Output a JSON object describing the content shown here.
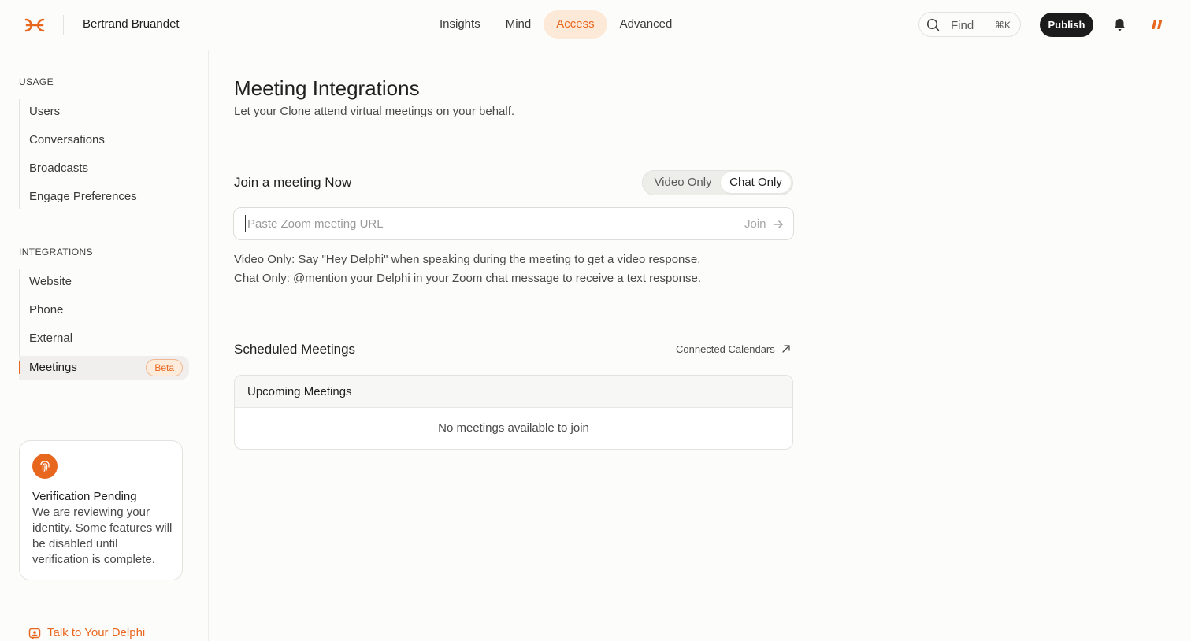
{
  "header": {
    "brand_name": "Bertrand Bruandet",
    "nav": [
      {
        "label": "Insights",
        "active": false
      },
      {
        "label": "Mind",
        "active": false
      },
      {
        "label": "Access",
        "active": true
      },
      {
        "label": "Advanced",
        "active": false
      }
    ],
    "find_label": "Find",
    "find_shortcut": "⌘K",
    "publish_label": "Publish",
    "icons": {
      "logo": "delphi-logo-icon",
      "search": "search-icon",
      "bell": "bell-icon",
      "app": "app-mark-icon"
    }
  },
  "sidebar": {
    "usage_title": "USAGE",
    "usage_items": [
      "Users",
      "Conversations",
      "Broadcasts",
      "Engage Preferences"
    ],
    "integrations_title": "INTEGRATIONS",
    "integration_items": [
      "Website",
      "Phone",
      "External",
      "Meetings"
    ],
    "active_item": "Meetings",
    "beta_badge": "Beta",
    "verification": {
      "title": "Verification Pending",
      "text": "We are reviewing your identity. Some features will be disabled until verification is complete."
    },
    "talk_link": "Talk to Your Delphi"
  },
  "main": {
    "title": "Meeting Integrations",
    "subtitle": "Let your Clone attend virtual meetings on your behalf.",
    "join": {
      "heading": "Join a meeting Now",
      "modes": [
        "Video Only",
        "Chat Only"
      ],
      "selected_mode": "Chat Only",
      "url_placeholder": "Paste Zoom meeting URL",
      "url_value": "",
      "join_label": "Join",
      "help_video": "Video Only: Say \"Hey Delphi\" when speaking during the meeting to get a video response.",
      "help_chat": "Chat Only: @mention your Delphi in your Zoom chat message to receive a text response."
    },
    "scheduled": {
      "heading": "Scheduled Meetings",
      "calendars_link": "Connected Calendars",
      "card_title": "Upcoming Meetings",
      "empty_text": "No meetings available to join"
    }
  },
  "colors": {
    "accent": "#e8671e",
    "accent_soft": "#fde9d8",
    "dark_button": "#1c1c1c",
    "background": "#fcfcfb"
  }
}
